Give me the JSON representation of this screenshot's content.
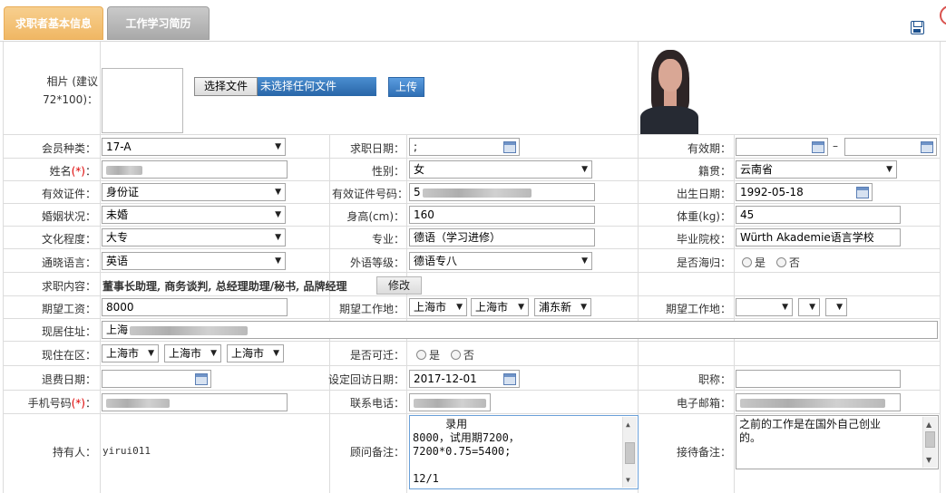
{
  "tabs": [
    {
      "label": "求职者基本信息",
      "active": true
    },
    {
      "label": "工作学习简历",
      "active": false
    }
  ],
  "colors": {
    "tab_active": "#f0b764",
    "tab_inactive": "#a9a9a9",
    "upload": "#2f6fb4",
    "required": "#dd0000"
  },
  "photo": {
    "label_line1": "相片 (建议",
    "label_line2": "72*100)：",
    "choose_file_label": "选择文件",
    "no_file_text": "未选择任何文件",
    "upload_label": "上传"
  },
  "fields": {
    "member_type": {
      "label": "会员种类：",
      "value": "17-A"
    },
    "job_date": {
      "label": "求职日期：",
      "value": ";"
    },
    "valid_period": {
      "label": "有效期：",
      "value_start": "",
      "dash": "–",
      "value_end": ""
    },
    "name": {
      "label": "姓名",
      "req": "(*)",
      "colon": "："
    },
    "gender": {
      "label": "性别：",
      "value": "女"
    },
    "native": {
      "label": "籍贯：",
      "value": "云南省"
    },
    "id_type": {
      "label": "有效证件：",
      "value": "身份证"
    },
    "id_number": {
      "label": "有效证件号码：",
      "value": "5"
    },
    "birth": {
      "label": "出生日期：",
      "value": "1992-05-18"
    },
    "marital": {
      "label": "婚姻状况：",
      "value": "未婚"
    },
    "height": {
      "label": "身高(cm)：",
      "value": "160"
    },
    "weight": {
      "label": "体重(kg)：",
      "value": "45"
    },
    "education": {
      "label": "文化程度：",
      "value": "大专"
    },
    "major": {
      "label": "专业：",
      "value": "德语（学习进修）"
    },
    "school": {
      "label": "毕业院校：",
      "value": "Würth Akademie语言学校"
    },
    "language": {
      "label": "通晓语言：",
      "value": "英语"
    },
    "foreign_level": {
      "label": "外语等级：",
      "value": "德语专八"
    },
    "returnee": {
      "label": "是否海归：",
      "opt_yes": "是",
      "opt_no": "否"
    },
    "job_content": {
      "label": "求职内容：",
      "value": "董事长助理, 商务谈判, 总经理助理/秘书, 品牌经理",
      "modify_label": "修改"
    },
    "salary": {
      "label": "期望工资：",
      "value": "8000"
    },
    "work_place1": {
      "label": "期望工作地：",
      "province": "上海市",
      "city": "上海市",
      "district": "浦东新"
    },
    "work_place2": {
      "label": "期望工作地：",
      "province": "",
      "city": "",
      "district": ""
    },
    "address": {
      "label": "现居住址：",
      "value": "上海"
    },
    "region": {
      "label": "现住在区：",
      "province": "上海市",
      "city": "上海市",
      "district": "上海市"
    },
    "relocate": {
      "label": "是否可迁：",
      "opt_yes": "是",
      "opt_no": "否"
    },
    "refund_date": {
      "label": "退费日期：",
      "value": ""
    },
    "callback_date": {
      "label": "设定回访日期：",
      "value": "2017-12-01"
    },
    "title": {
      "label": "职称：",
      "value": ""
    },
    "mobile": {
      "label": "手机号码",
      "req": "(*)",
      "colon": "："
    },
    "phone": {
      "label": "联系电话："
    },
    "email": {
      "label": "电子邮箱："
    },
    "holder": {
      "label": "持有人：",
      "value": "yirui011"
    },
    "advisor_note": {
      "label": "顾问备注：",
      "value": "     录用\n8000，试用期7200，\n7200*0.75=5400;\n\n12/1"
    },
    "reception_note": {
      "label": "接待备注：",
      "value": "之前的工作是在国外自己创业\n的。"
    }
  },
  "icons": {
    "save": "save-icon",
    "calendar": "calendar-icon",
    "dropdown": "chevron-down-icon"
  }
}
